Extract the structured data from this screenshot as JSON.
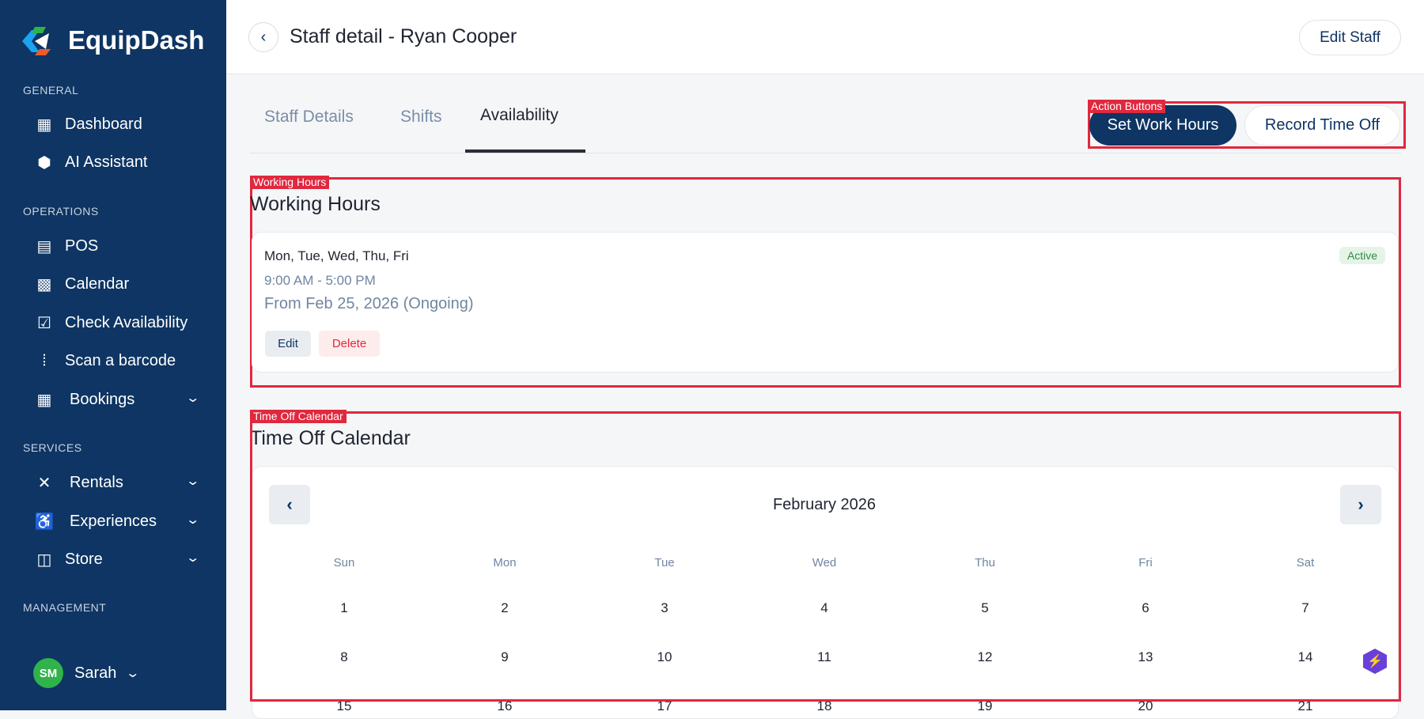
{
  "app": {
    "name": "EquipDash"
  },
  "sidebar": {
    "sections": {
      "general": "GENERAL",
      "operations": "OPERATIONS",
      "services": "SERVICES",
      "management": "MANAGEMENT"
    },
    "items": [
      {
        "label": "Dashboard",
        "icon": "grid-icon"
      },
      {
        "label": "AI Assistant",
        "icon": "ai-hexagon-icon"
      },
      {
        "label": "POS",
        "icon": "pos-terminal-icon"
      },
      {
        "label": "Calendar",
        "icon": "calendar-icon"
      },
      {
        "label": "Check Availability",
        "icon": "calendar-check-icon"
      },
      {
        "label": "Scan a barcode",
        "icon": "barcode-scan-icon"
      },
      {
        "label": "Bookings",
        "icon": "bookings-icon"
      },
      {
        "label": "Rentals",
        "icon": "rentals-icon"
      },
      {
        "label": "Experiences",
        "icon": "experiences-icon"
      },
      {
        "label": "Store",
        "icon": "store-bag-icon"
      }
    ],
    "user": {
      "initials": "SM",
      "name": "Sarah",
      "avatar_color": "#2fb34a"
    }
  },
  "header": {
    "title": "Staff detail - Ryan Cooper",
    "edit_label": "Edit Staff"
  },
  "tabs": [
    {
      "label": "Staff Details"
    },
    {
      "label": "Shifts"
    },
    {
      "label": "Availability",
      "active": true
    }
  ],
  "annotations": {
    "actions": "Action Buttons",
    "working": "Working Hours",
    "timeoff": "Time Off Calendar"
  },
  "actions": {
    "set_hours": "Set Work Hours",
    "record_time_off": "Record Time Off"
  },
  "working_hours": {
    "title": "Working Hours",
    "days": "Mon, Tue, Wed, Thu, Fri",
    "time": "9:00 AM - 5:00 PM",
    "range": "From Feb 25, 2026 (Ongoing)",
    "status": "Active",
    "edit": "Edit",
    "delete": "Delete"
  },
  "time_off": {
    "title": "Time Off Calendar",
    "month": "February 2026",
    "weekdays": [
      "Sun",
      "Mon",
      "Tue",
      "Wed",
      "Thu",
      "Fri",
      "Sat"
    ],
    "weeks": [
      [
        "1",
        "2",
        "3",
        "4",
        "5",
        "6",
        "7"
      ],
      [
        "8",
        "9",
        "10",
        "11",
        "12",
        "13",
        "14"
      ],
      [
        "15",
        "16",
        "17",
        "18",
        "19",
        "20",
        "21"
      ]
    ]
  },
  "colors": {
    "brand": "#0e3563",
    "accent_red": "#e0283e",
    "active_green": "#2e8b45"
  }
}
